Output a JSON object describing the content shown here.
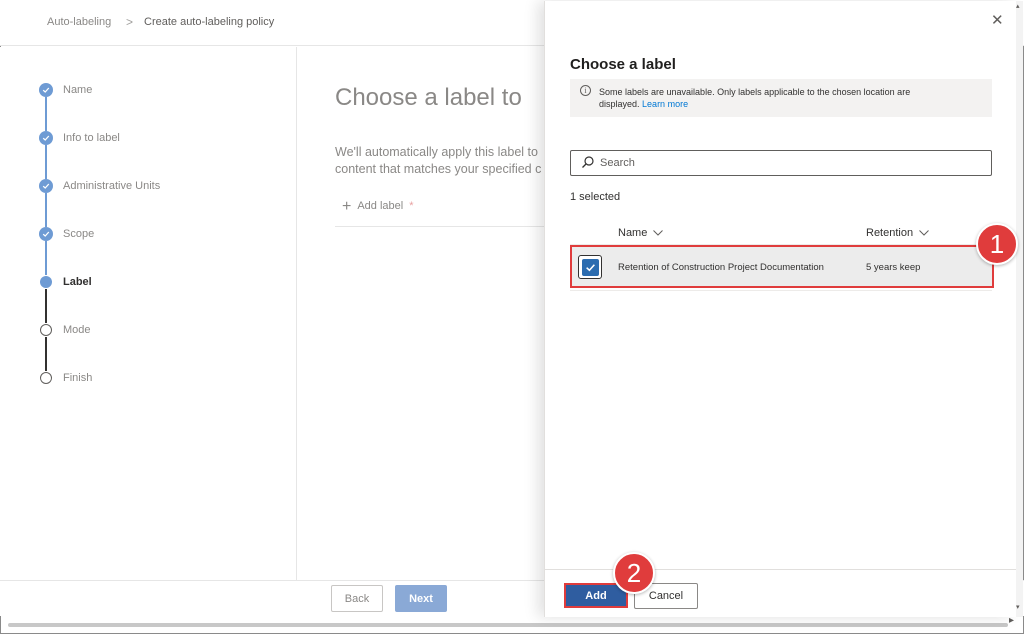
{
  "breadcrumb": {
    "items": [
      "Auto-labeling",
      "Create auto-labeling policy"
    ],
    "separator": ">"
  },
  "steps": [
    {
      "label": "Name",
      "state": "done"
    },
    {
      "label": "Info to label",
      "state": "done"
    },
    {
      "label": "Administrative Units",
      "state": "done"
    },
    {
      "label": "Scope",
      "state": "done"
    },
    {
      "label": "Label",
      "state": "current"
    },
    {
      "label": "Mode",
      "state": "todo"
    },
    {
      "label": "Finish",
      "state": "todo"
    }
  ],
  "main": {
    "title": "Choose a label to",
    "description_line1": "We'll automatically apply this label to",
    "description_line2": "content that matches your specified c",
    "add_label": "Add label",
    "required_marker": "*"
  },
  "footer": {
    "back_label": "Back",
    "next_label": "Next"
  },
  "panel": {
    "title": "Choose a label",
    "info_text": "Some labels are unavailable. Only labels applicable to the chosen location are displayed.",
    "info_link": "Learn more",
    "search_placeholder": "Search",
    "selected_count": "1 selected",
    "columns": {
      "name": "Name",
      "retention": "Retention"
    },
    "rows": [
      {
        "name": "Retention of Construction Project Documentation",
        "retention": "5 years keep",
        "checked": true
      }
    ],
    "add_label": "Add",
    "cancel_label": "Cancel"
  },
  "callouts": [
    "1",
    "2"
  ],
  "colors": {
    "accent": "#6e9bd4",
    "primary_button": "#2f5da0",
    "highlight": "#e03c3c",
    "link": "#0078d4"
  }
}
